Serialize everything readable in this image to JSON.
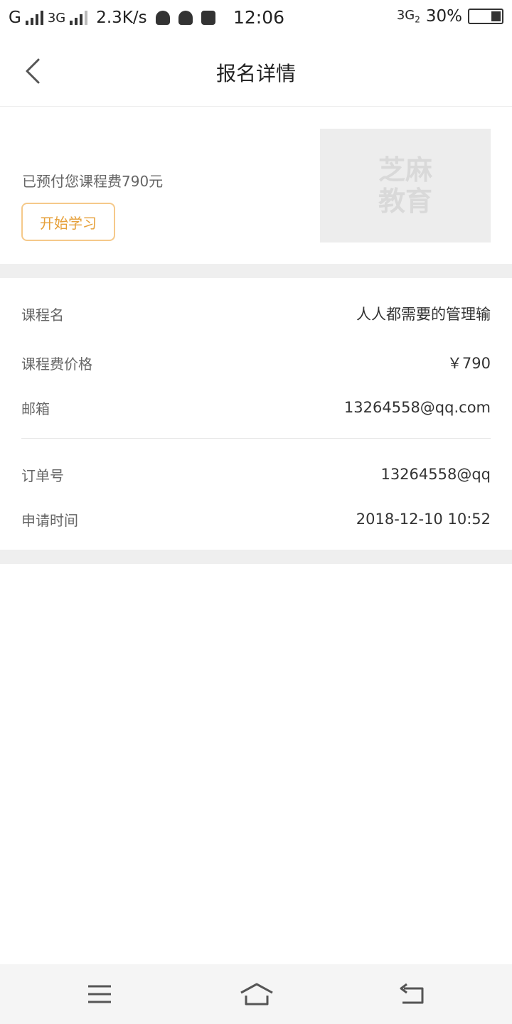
{
  "status_bar": {
    "carrier1": "G",
    "carrier2": "3G",
    "speed": "2.3K/s",
    "time": "12:06",
    "network_right": "3G",
    "network_sub": "2",
    "battery": "30%",
    "battery_level": 0.3
  },
  "header": {
    "title": "报名详情"
  },
  "summary": {
    "prepaid_text": "已预付您课程费790元",
    "start_button": "开始学习",
    "cover_logo": "芝麻教育"
  },
  "details": {
    "rows": [
      {
        "label": "课程名",
        "value": "人人都需要的管理输"
      },
      {
        "label": "课程费价格",
        "value": "￥790"
      },
      {
        "label": "邮箱",
        "value": "13264558@qq.com"
      },
      {
        "label": "订单号",
        "value": "13264558@qq"
      },
      {
        "label": "申请时间",
        "value": "2018-12-10 10:52"
      }
    ]
  },
  "navbar": {
    "icons": [
      "menu-icon",
      "home-icon",
      "back-icon"
    ]
  },
  "colors": {
    "accent": "#e6a03a",
    "accent_border": "#f5c98a",
    "separator": "#efefef",
    "cover_bg": "#ededed"
  }
}
